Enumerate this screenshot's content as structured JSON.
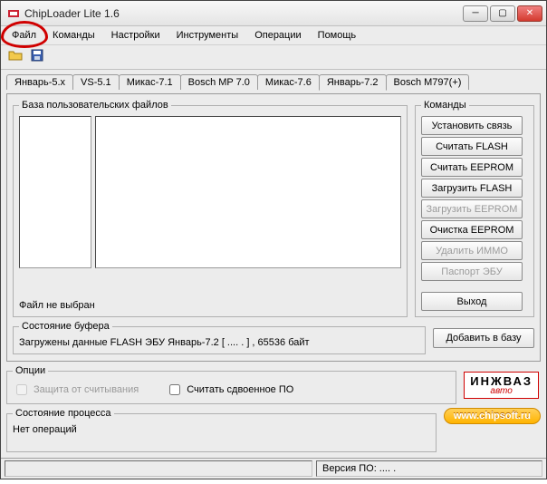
{
  "title": "ChipLoader Lite 1.6",
  "menu": [
    "Файл",
    "Команды",
    "Настройки",
    "Инструменты",
    "Операции",
    "Помощь"
  ],
  "toolbar": {
    "open_icon": "folder-open-icon",
    "save_icon": "save-icon"
  },
  "tabs": [
    "Январь-5.x",
    "VS-5.1",
    "Микас-7.1",
    "Bosch MP 7.0",
    "Микас-7.6",
    "Январь-7.2",
    "Bosch M797(+)"
  ],
  "active_tab_index": 5,
  "userfiles_group": "База пользовательских файлов",
  "file_status": "Файл не выбран",
  "commands_group": "Команды",
  "command_buttons": [
    {
      "label": "Установить связь",
      "enabled": true
    },
    {
      "label": "Считать FLASH",
      "enabled": true
    },
    {
      "label": "Считать EEPROM",
      "enabled": true
    },
    {
      "label": "Загрузить FLASH",
      "enabled": true
    },
    {
      "label": "Загрузить EEPROM",
      "enabled": false
    },
    {
      "label": "Очистка EEPROM",
      "enabled": true
    },
    {
      "label": "Удалить ИММО",
      "enabled": false
    },
    {
      "label": "Паспорт ЭБУ",
      "enabled": false
    }
  ],
  "exit_label": "Выход",
  "buffer_group": "Состояние буфера",
  "buffer_text": "Загружены данные FLASH ЭБУ Январь-7.2 [   .... . ] , 65536 байт",
  "add_db_label": "Добавить в базу",
  "options_group": "Опции",
  "opt_protect": "Защита от считывания",
  "opt_dual": "Считать сдвоенное ПО",
  "process_group": "Состояние процесса",
  "process_text": "Нет операций",
  "logo_main": "ИНЖВАЗ",
  "logo_sub": "авто",
  "url": "www.chipsoft.ru",
  "status_version": "Версия ПО:  .... ."
}
